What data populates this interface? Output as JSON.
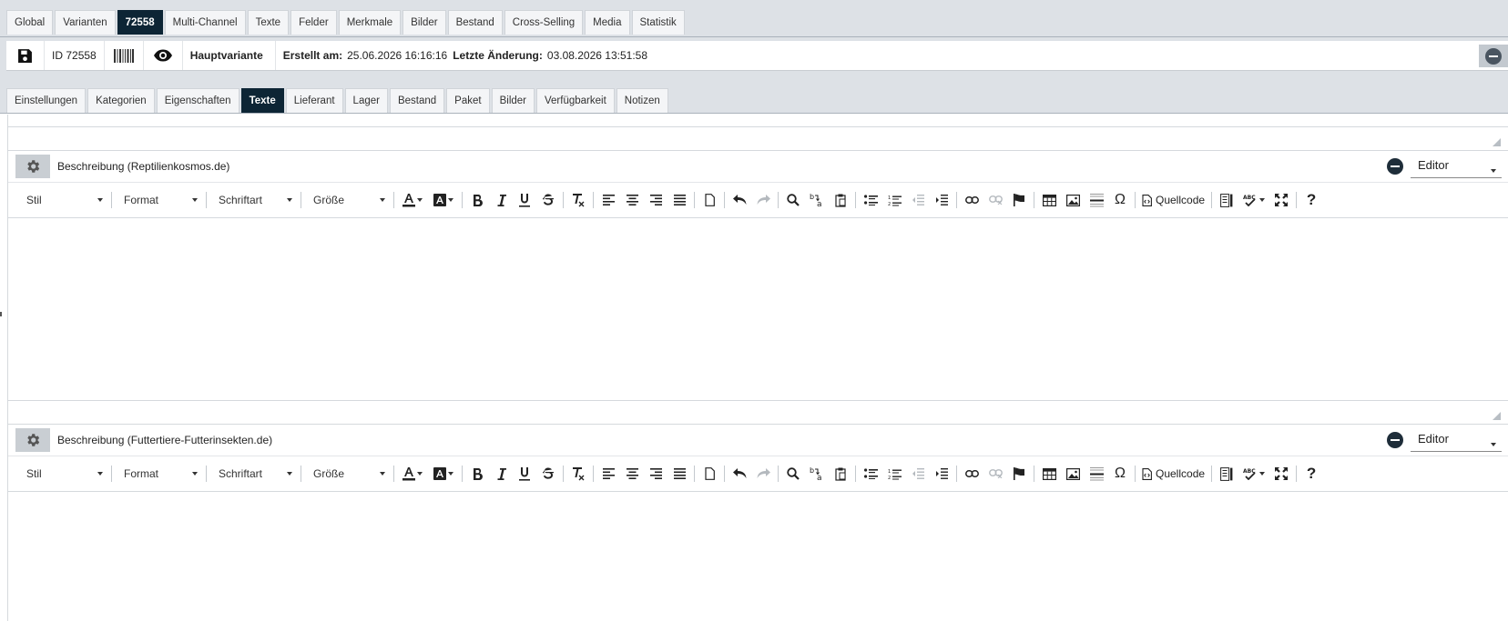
{
  "main_tabs": [
    "Global",
    "Varianten",
    "72558",
    "Multi-Channel",
    "Texte",
    "Felder",
    "Merkmale",
    "Bilder",
    "Bestand",
    "Cross-Selling",
    "Media",
    "Statistik"
  ],
  "main_active": "72558",
  "info": {
    "id_label": "ID",
    "id_value": "72558",
    "variant": "Hauptvariante",
    "created_label": "Erstellt am:",
    "created_value": "25.06.2026 16:16:16",
    "changed_label": "Letzte Änderung:",
    "changed_value": "03.08.2026 13:51:58"
  },
  "sub_tabs": [
    "Einstellungen",
    "Kategorien",
    "Eigenschaften",
    "Texte",
    "Lieferant",
    "Lager",
    "Bestand",
    "Paket",
    "Bilder",
    "Verfügbarkeit",
    "Notizen"
  ],
  "sub_active": "Texte",
  "toolbar": {
    "style": "Stil",
    "format": "Format",
    "font": "Schriftart",
    "size": "Größe",
    "source": "Quellcode"
  },
  "sections": [
    {
      "title": "Beschreibung (Reptilienkosmos.de)",
      "mode": "Editor"
    },
    {
      "title": "Beschreibung (Futtertiere-Futterinsekten.de)",
      "mode": "Editor"
    }
  ],
  "colors": {
    "active_tab": "#0d2535",
    "top_background": "#dde1e6",
    "gear_button": "#c9ced3"
  }
}
